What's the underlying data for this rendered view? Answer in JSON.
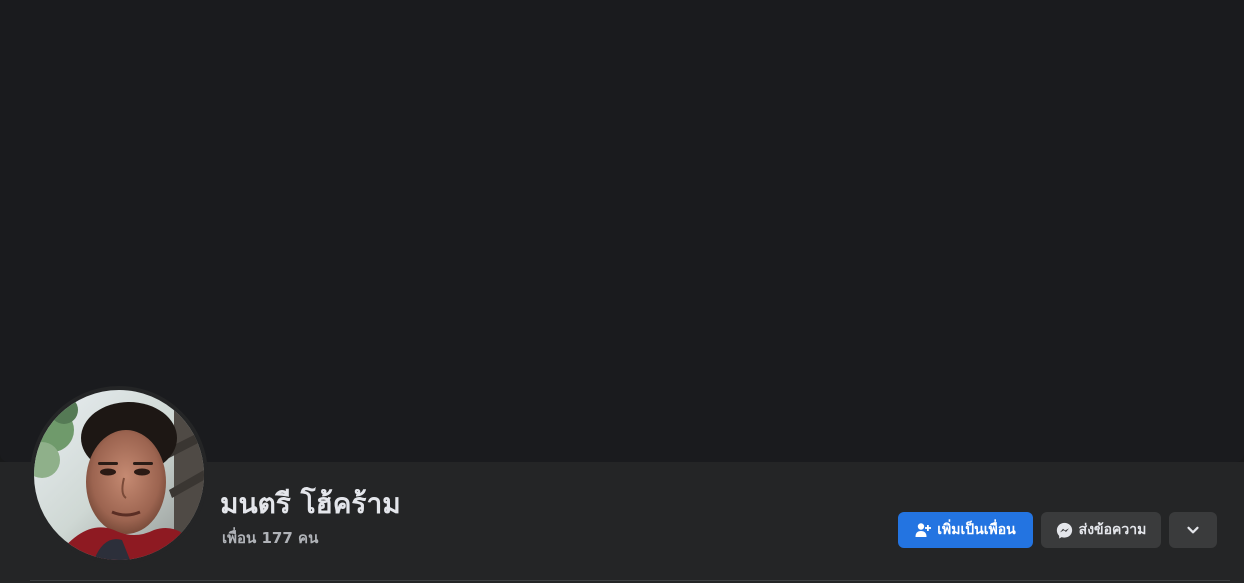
{
  "profile": {
    "name": "มนตรี โฮ้คร้าม",
    "friends_text": "เพื่อน 177 คน",
    "avatar_icon": "profile-photo"
  },
  "actions": {
    "add_friend_label": "เพิ่มเป็นเพื่อน",
    "add_friend_icon": "add-friend-icon",
    "message_label": "ส่งข้อความ",
    "message_icon": "messenger-icon",
    "more_icon": "chevron-down-icon"
  },
  "colors": {
    "accent": "#2374e1",
    "background": "#18191a",
    "surface": "#242526",
    "button_secondary": "#3a3b3c",
    "text_primary": "#e4e6eb",
    "text_secondary": "#b0b3b8"
  }
}
